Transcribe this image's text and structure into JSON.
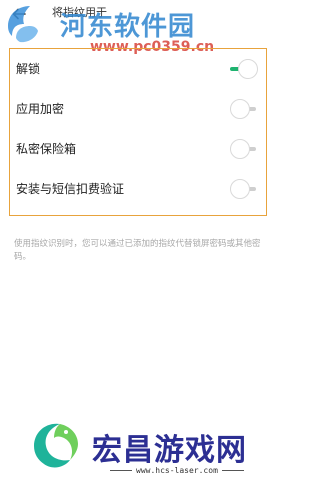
{
  "header": {
    "title": "将指纹用于"
  },
  "options": [
    {
      "label": "解锁",
      "on": true
    },
    {
      "label": "应用加密",
      "on": false
    },
    {
      "label": "私密保险箱",
      "on": false
    },
    {
      "label": "安装与短信扣费验证",
      "on": false
    }
  ],
  "description": "使用指纹识别时，您可以通过已添加的指纹代替锁屏密码或其他密码。",
  "watermark": {
    "top_name": "河东软件园",
    "top_url": "www.pc0359.cn",
    "bottom_name": "宏昌游戏网",
    "bottom_url": "www.hcs-laser.com"
  },
  "colors": {
    "accent_on": "#1fb370",
    "highlight_border": "#e8a33c",
    "top_watermark": "#2f86cf",
    "bottom_watermark": "#2c2f93"
  },
  "icons": {
    "back": "arrow-left-icon"
  }
}
